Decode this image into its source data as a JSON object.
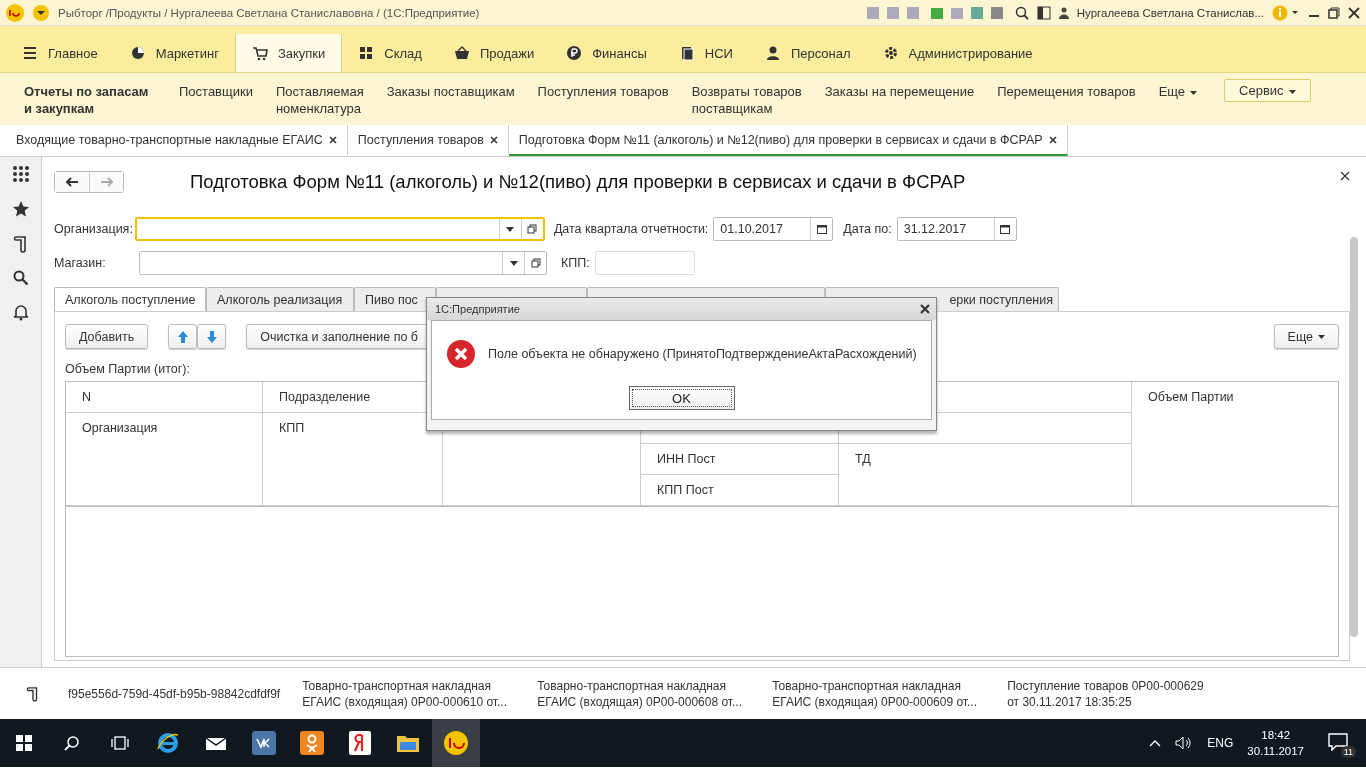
{
  "title_bar": {
    "title": "Рыбторг /Продукты / Нургалеева Светлана Станиславовна /  (1С:Предприятие)",
    "user": "Нургалеева Светлана Станислав..."
  },
  "sections": [
    {
      "label": "Главное",
      "selected": false
    },
    {
      "label": "Маркетинг",
      "selected": false
    },
    {
      "label": "Закупки",
      "selected": true
    },
    {
      "label": "Склад",
      "selected": false
    },
    {
      "label": "Продажи",
      "selected": false
    },
    {
      "label": "Финансы",
      "selected": false
    },
    {
      "label": "НСИ",
      "selected": false
    },
    {
      "label": "Персонал",
      "selected": false
    },
    {
      "label": "Администрирование",
      "selected": false
    }
  ],
  "subnav": {
    "heading": [
      "Отчеты по запасам",
      "и закупкам"
    ],
    "items": [
      [
        "Поставщики"
      ],
      [
        "Поставляемая",
        "номенклатура"
      ],
      [
        "Заказы поставщикам"
      ],
      [
        "Поступления товаров"
      ],
      [
        "Возвраты товаров",
        "поставщикам"
      ],
      [
        "Заказы на перемещение"
      ],
      [
        "Перемещения товаров"
      ]
    ],
    "more": "Еще",
    "service": "Сервис"
  },
  "open_tabs": [
    {
      "label": "Входящие товарно-транспортные накладные ЕГАИС",
      "selected": false
    },
    {
      "label": "Поступления товаров",
      "selected": false
    },
    {
      "label": "Подготовка Форм №11 (алкоголь) и №12(пиво) для проверки в сервисах и сдачи в ФСРАР",
      "selected": true
    }
  ],
  "form": {
    "title": "Подготовка Форм №11 (алкоголь) и №12(пиво) для проверки в сервисах и сдачи в ФСРАР",
    "org_label": "Организация:",
    "date_from_label": "Дата квартала отчетности:",
    "date_from": "01.10.2017",
    "date_to_label": "Дата по:",
    "date_to": "31.12.2017",
    "shop_label": "Магазин:",
    "kpp_label": "КПП:"
  },
  "inner_tabs": [
    {
      "label": "Алкоголь поступление",
      "selected": true
    },
    {
      "label": "Алкоголь реализация",
      "selected": false
    },
    {
      "label": "Пиво пос",
      "selected": false
    },
    {
      "selected": false
    },
    {
      "selected": false
    },
    {
      "label": "ерки поступления",
      "selected": false
    }
  ],
  "toolbar": {
    "add": "Добавить",
    "fill": "Очистка и заполнение по б",
    "more": "Еще"
  },
  "total_label": "Объем Партии (итог):",
  "table": {
    "headers": [
      "N",
      "Подразделение",
      "Объем Партии"
    ],
    "cells": [
      "Организация",
      "КПП",
      "ИНН Пост",
      "КПП Пост",
      "ТД"
    ]
  },
  "dialog": {
    "title": "1С:Предприятие",
    "message": "Поле объекта не обнаружено (ПринятоПодтверждениеАктаРасхождений)",
    "button": "OK"
  },
  "history": [
    {
      "lines": [
        "f95e556d-759d-45df-b95b-98842cdfdf9f"
      ]
    },
    {
      "lines": [
        "Товарно-транспортная накладная",
        "ЕГАИС (входящая) 0Р00-000610 от..."
      ]
    },
    {
      "lines": [
        "Товарно-транспортная накладная",
        "ЕГАИС (входящая) 0Р00-000608 от..."
      ]
    },
    {
      "lines": [
        "Товарно-транспортная накладная",
        "ЕГАИС (входящая) 0Р00-000609 от..."
      ]
    },
    {
      "lines": [
        "Поступление товаров 0Р00-000629",
        "от 30.11.2017 18:35:25"
      ]
    }
  ],
  "taskbar": {
    "lang": "ENG",
    "time": "18:42",
    "date": "30.11.2017",
    "notifications": "11"
  }
}
